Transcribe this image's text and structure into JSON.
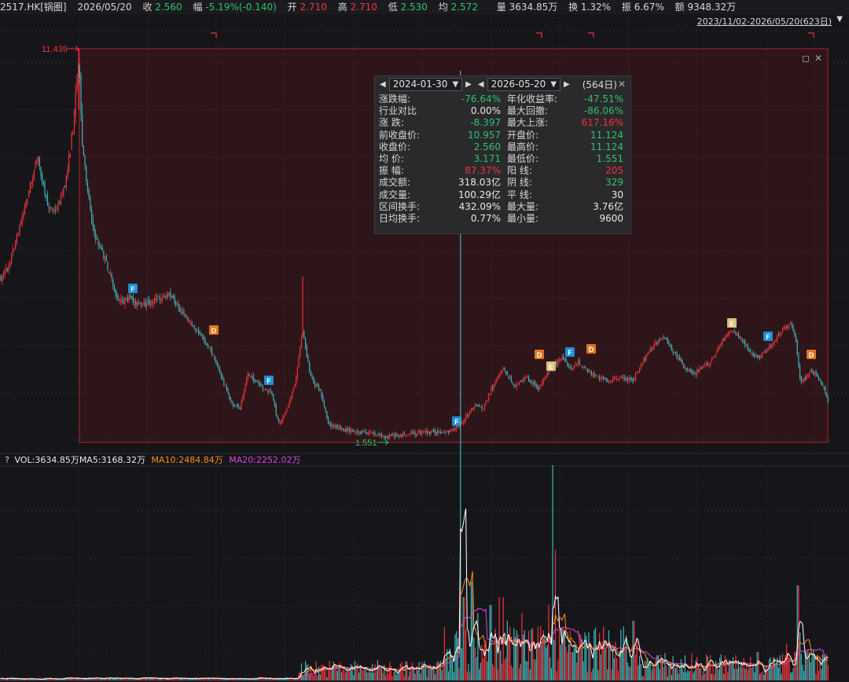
{
  "header": {
    "symbol": "2517.HK[锅圈]",
    "date": "2026/05/20",
    "close_label": "收",
    "close": "2.560",
    "chg_label": "幅",
    "chg": "-5.19%(-0.140)",
    "open_label": "开",
    "open": "2.710",
    "high_label": "高",
    "high": "2.710",
    "low_label": "低",
    "low": "2.530",
    "avg_label": "均",
    "avg": "2.572",
    "vol_label": "量",
    "vol": "3634.85万",
    "turn_label": "换",
    "turn": "1.32%",
    "amp_label": "振",
    "amp": "6.67%",
    "amt_label": "额",
    "amt": "9348.32万"
  },
  "range_link": "2023/11/02-2026/05/20(623日)",
  "price_panel": {
    "max_label": "11.439",
    "min_label": "1.551",
    "event_markers": [
      "F",
      "D",
      "F",
      "F",
      "D",
      "E",
      "F",
      "D",
      "E",
      "F",
      "D"
    ]
  },
  "stats": {
    "start_date": "2024-01-30",
    "end_date": "2026-05-20",
    "days": "(564日)",
    "rows": [
      {
        "l": "涨跌幅:",
        "v": "-76.64%",
        "vc": "#2ec26a",
        "l2": "年化收益率:",
        "v2": "-47.51%",
        "v2c": "#2ec26a"
      },
      {
        "l": "行业对比",
        "v": "0.00%",
        "vc": "#e8e8e8",
        "l2": "最大回撤:",
        "v2": "-86.06%",
        "v2c": "#2ec26a"
      },
      {
        "l": "涨  跌:",
        "v": "-8.397",
        "vc": "#2ec26a",
        "l2": "最大上涨:",
        "v2": "617.16%",
        "v2c": "#f0333a"
      },
      {
        "l": "前收盘价:",
        "v": "10.957",
        "vc": "#2ec26a",
        "l2": "开盘价:",
        "v2": "11.124",
        "v2c": "#2ec26a"
      },
      {
        "l": "收盘价:",
        "v": "2.560",
        "vc": "#2ec26a",
        "l2": "最高价:",
        "v2": "11.124",
        "v2c": "#2ec26a"
      },
      {
        "l": "均  价:",
        "v": "3.171",
        "vc": "#2ec26a",
        "l2": "最低价:",
        "v2": "1.551",
        "v2c": "#2ec26a"
      },
      {
        "l": "振  幅:",
        "v": "87.37%",
        "vc": "#f0333a",
        "l2": "阳  线:",
        "v2": "205",
        "v2c": "#f0333a"
      },
      {
        "l": "成交额:",
        "v": "318.03亿",
        "vc": "#e8e8e8",
        "l2": "阴  线:",
        "v2": "329",
        "v2c": "#2ec26a"
      },
      {
        "l": "成交量:",
        "v": "100.29亿",
        "vc": "#e8e8e8",
        "l2": "平  线:",
        "v2": "30",
        "v2c": "#e8e8e8"
      },
      {
        "l": "区间换手:",
        "v": "432.09%",
        "vc": "#e8e8e8",
        "l2": "最大量:",
        "v2": "3.76亿",
        "v2c": "#e8e8e8"
      },
      {
        "l": "日均换手:",
        "v": "0.77%",
        "vc": "#e8e8e8",
        "l2": "最小量:",
        "v2": "9600",
        "v2c": "#e8e8e8"
      }
    ]
  },
  "volume": {
    "help": "?",
    "vol": "VOL:3634.85万",
    "ma5": "MA5:3168.32万",
    "ma10": "MA10:2484.84万",
    "ma20": "MA20:2252.02万"
  },
  "colors": {
    "up": "#f0333a",
    "down": "#2ec26a",
    "candle_down": "#3fb5b8",
    "ma5": "#ffffff",
    "ma10": "#ff8c1a",
    "ma20": "#e040e0",
    "F": "#1f8fd6",
    "D": "#e0761c",
    "E": "#d9c079"
  }
}
